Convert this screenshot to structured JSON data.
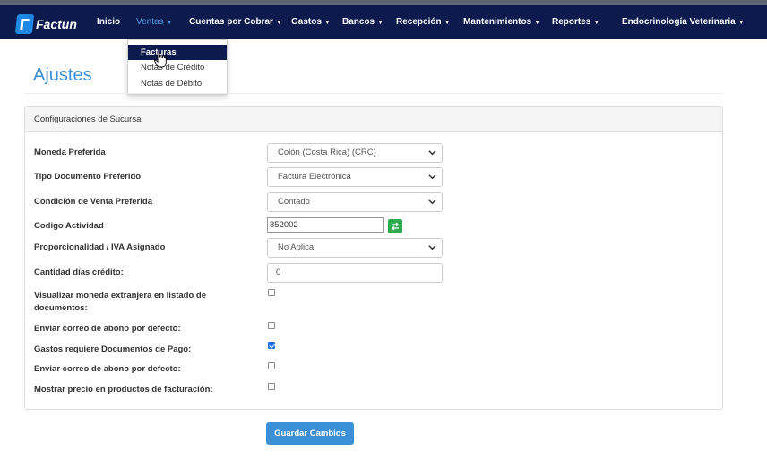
{
  "navbar": {
    "logo_text": "Factun",
    "items": [
      {
        "label": "Inicio"
      },
      {
        "label": "Ventas"
      },
      {
        "label": "Cuentas por Cobrar"
      },
      {
        "label": "Gastos"
      },
      {
        "label": "Bancos"
      },
      {
        "label": "Recepción"
      },
      {
        "label": "Mantenimientos"
      },
      {
        "label": "Reportes"
      },
      {
        "label": "Endocrinología Veterinaria"
      }
    ]
  },
  "ventas_menu": {
    "items": [
      {
        "label": "Facturas"
      },
      {
        "label": "Notas de Crédito"
      },
      {
        "label": "Notas de Débito"
      }
    ]
  },
  "page": {
    "title": "Ajustes"
  },
  "panel": {
    "heading": "Configuraciones de Sucursal",
    "fields": {
      "moneda": {
        "label": "Moneda Preferida",
        "value": "Colón (Costa Rica) (CRC)"
      },
      "tipo_documento": {
        "label": "Tipo Documento Preferido",
        "value": "Factura Electrónica"
      },
      "condicion_venta": {
        "label": "Condición de Venta Preferida",
        "value": "Contado"
      },
      "codigo_actividad": {
        "label": "Codigo Actividad",
        "value": "852002"
      },
      "proporcionalidad": {
        "label": "Proporcionalidad / IVA Asignado",
        "value": "No Aplica"
      },
      "dias_credito": {
        "label": "Cantidad días crédito:",
        "value": "0"
      },
      "visualizar_moneda": {
        "label_line1": "Visualizar moneda extranjera en listado de",
        "label_line2": "documentos:",
        "checked": false
      },
      "correo_abono_1": {
        "label": "Enviar correo de abono por defecto:",
        "checked": false
      },
      "gastos_documentos": {
        "label": "Gastos requiere Documentos de Pago:",
        "checked": true
      },
      "correo_abono_2": {
        "label": "Enviar correo de abono por defecto:",
        "checked": false
      },
      "mostrar_precio": {
        "label": "Mostrar precio en productos de facturación:",
        "checked": false
      }
    }
  },
  "actions": {
    "save_label": "Guardar Cambios"
  },
  "colors": {
    "navbar": "#0d1a4e",
    "accent": "#3a8fd6",
    "success": "#2eaa4f",
    "checkbox": "#1a73e8"
  }
}
